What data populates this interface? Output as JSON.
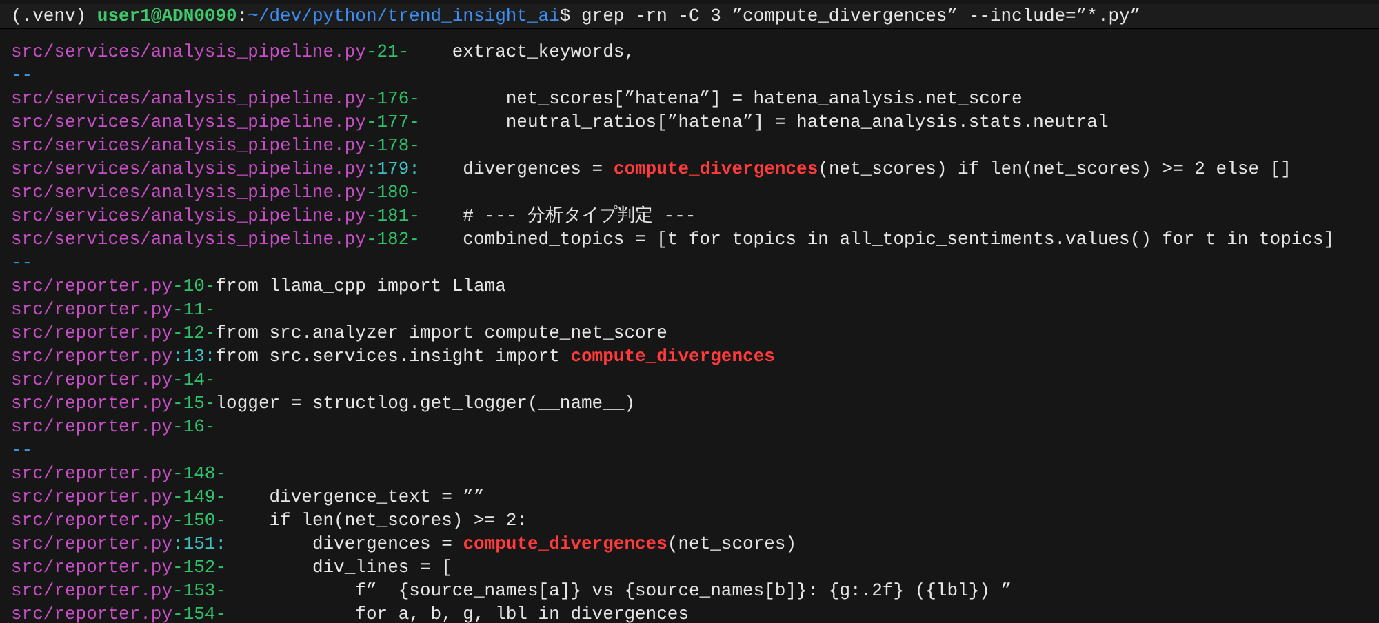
{
  "prompt": {
    "venv": "(.venv)",
    "user_host": "user1@ADN0090",
    "colon": ":",
    "path": "~/dev/python/trend_insight_ai",
    "command": "$ grep -rn -C 3 ”compute_divergences” --include=”*.py”"
  },
  "lines": [
    {
      "kind": "context",
      "file": "src/services/analysis_pipeline.py",
      "ln": "-21-",
      "code": [
        {
          "text": "    extract_keywords,",
          "match": false
        }
      ]
    },
    {
      "kind": "separator",
      "text": "--"
    },
    {
      "kind": "context",
      "file": "src/services/analysis_pipeline.py",
      "ln": "-176-",
      "code": [
        {
          "text": "        net_scores[”hatena”] = hatena_analysis.net_score",
          "match": false
        }
      ]
    },
    {
      "kind": "context",
      "file": "src/services/analysis_pipeline.py",
      "ln": "-177-",
      "code": [
        {
          "text": "        neutral_ratios[”hatena”] = hatena_analysis.stats.neutral",
          "match": false
        }
      ]
    },
    {
      "kind": "context",
      "file": "src/services/analysis_pipeline.py",
      "ln": "-178-"
    },
    {
      "kind": "match",
      "file": "src/services/analysis_pipeline.py",
      "ln": ":179:",
      "code": [
        {
          "text": "    divergences = ",
          "match": false
        },
        {
          "text": "compute_divergences",
          "match": true
        },
        {
          "text": "(net_scores) if len(net_scores) >= 2 else []",
          "match": false
        }
      ]
    },
    {
      "kind": "context",
      "file": "src/services/analysis_pipeline.py",
      "ln": "-180-"
    },
    {
      "kind": "context",
      "file": "src/services/analysis_pipeline.py",
      "ln": "-181-",
      "code": [
        {
          "text": "    # --- 分析タイプ判定 ---",
          "match": false
        }
      ]
    },
    {
      "kind": "context",
      "file": "src/services/analysis_pipeline.py",
      "ln": "-182-",
      "code": [
        {
          "text": "    combined_topics = [t for topics in all_topic_sentiments.values() for t in topics]",
          "match": false
        }
      ]
    },
    {
      "kind": "separator",
      "text": "--"
    },
    {
      "kind": "context",
      "file": "src/reporter.py",
      "ln": "-10-",
      "code": [
        {
          "text": "from llama_cpp import Llama",
          "match": false
        }
      ]
    },
    {
      "kind": "context",
      "file": "src/reporter.py",
      "ln": "-11-"
    },
    {
      "kind": "context",
      "file": "src/reporter.py",
      "ln": "-12-",
      "code": [
        {
          "text": "from src.analyzer import compute_net_score",
          "match": false
        }
      ]
    },
    {
      "kind": "match",
      "file": "src/reporter.py",
      "ln": ":13:",
      "code": [
        {
          "text": "from src.services.insight import ",
          "match": false
        },
        {
          "text": "compute_divergences",
          "match": true
        }
      ]
    },
    {
      "kind": "context",
      "file": "src/reporter.py",
      "ln": "-14-"
    },
    {
      "kind": "context",
      "file": "src/reporter.py",
      "ln": "-15-",
      "code": [
        {
          "text": "logger = structlog.get_logger(__name__)",
          "match": false
        }
      ]
    },
    {
      "kind": "context",
      "file": "src/reporter.py",
      "ln": "-16-"
    },
    {
      "kind": "separator",
      "text": "--"
    },
    {
      "kind": "context",
      "file": "src/reporter.py",
      "ln": "-148-"
    },
    {
      "kind": "context",
      "file": "src/reporter.py",
      "ln": "-149-",
      "code": [
        {
          "text": "    divergence_text = ””",
          "match": false
        }
      ]
    },
    {
      "kind": "context",
      "file": "src/reporter.py",
      "ln": "-150-",
      "code": [
        {
          "text": "    if len(net_scores) >= 2:",
          "match": false
        }
      ]
    },
    {
      "kind": "match",
      "file": "src/reporter.py",
      "ln": ":151:",
      "code": [
        {
          "text": "        divergences = ",
          "match": false
        },
        {
          "text": "compute_divergences",
          "match": true
        },
        {
          "text": "(net_scores)",
          "match": false
        }
      ]
    },
    {
      "kind": "context",
      "file": "src/reporter.py",
      "ln": "-152-",
      "code": [
        {
          "text": "        div_lines = [",
          "match": false
        }
      ]
    },
    {
      "kind": "context",
      "file": "src/reporter.py",
      "ln": "-153-",
      "code": [
        {
          "text": "            f”  {source_names[a]} vs {source_names[b]}: {g:.2f} ({lbl}) ”",
          "match": false
        }
      ]
    },
    {
      "kind": "context",
      "file": "src/reporter.py",
      "ln": "-154-",
      "code": [
        {
          "text": "            for a, b, g, lbl in divergences",
          "match": false
        }
      ]
    }
  ]
}
